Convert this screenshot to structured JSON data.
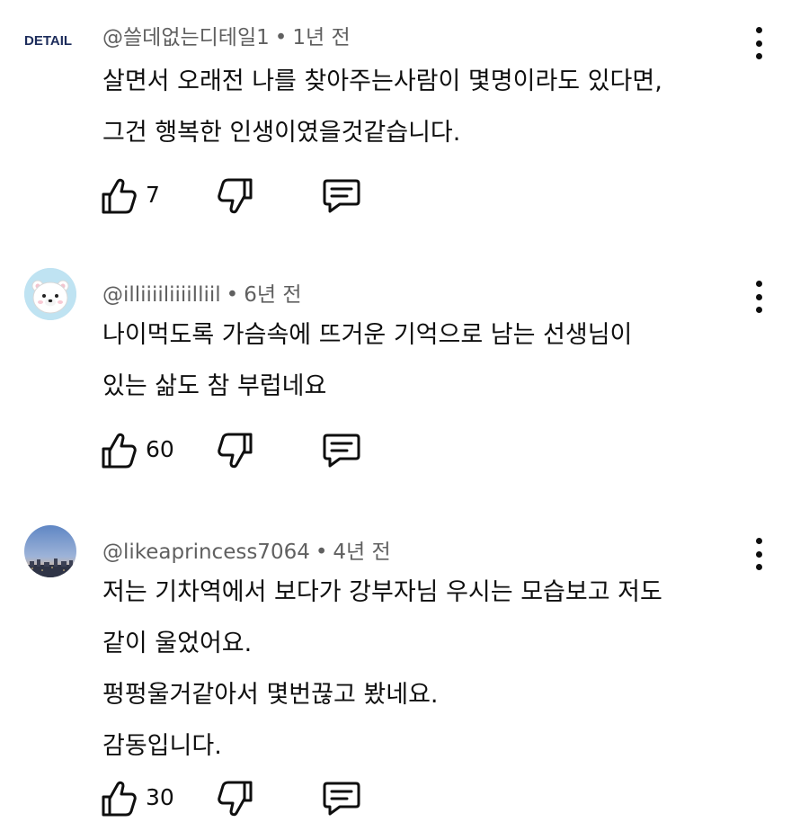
{
  "comments": [
    {
      "avatar_text": "DETAIL",
      "author": "@쓸데없는디테일1",
      "time": "1년 전",
      "lines": [
        "살면서 오래전 나를 찾아주는사람이 몇명이라도 있다면,",
        "그건 행복한 인생이였을것같습니다."
      ],
      "likes": "7"
    },
    {
      "avatar_icon": "polar-bear-icon",
      "author": "@illiiiiliiiilliil",
      "time": "6년 전",
      "lines": [
        "나이먹도록 가슴속에 뜨거운 기억으로 남는 선생님이",
        "있는 삶도 참 부럽네요"
      ],
      "likes": "60"
    },
    {
      "avatar_icon": "city-skyline-photo",
      "author": "@likeaprincess7064",
      "time": "4년 전",
      "lines": [
        "저는 기차역에서 보다가 강부자님 우시는 모습보고 저도",
        "같이 울었어요.",
        "펑펑울거같아서 몇번끊고 봤네요.",
        "감동입니다."
      ],
      "likes": "30"
    }
  ],
  "colors": {
    "text": "#0f0f0f",
    "meta": "#606060",
    "detail_logo": "#1c2c5b"
  }
}
